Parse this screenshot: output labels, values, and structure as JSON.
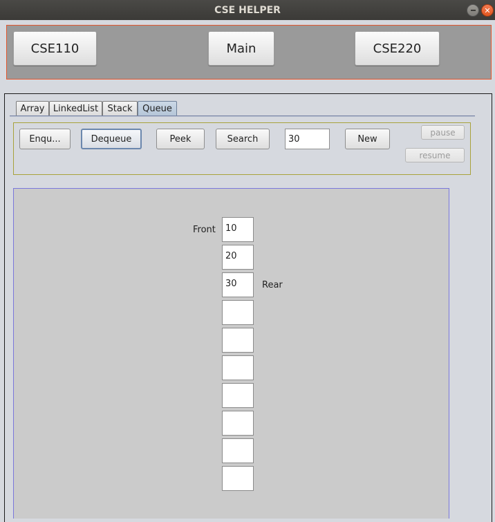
{
  "window": {
    "title": "CSE HELPER"
  },
  "nav": {
    "cse110": "CSE110",
    "main": "Main",
    "cse220": "CSE220"
  },
  "tabs": [
    "Array",
    "LinkedList",
    "Stack",
    "Queue"
  ],
  "active_tab": "Queue",
  "controls": {
    "enqueue": "Enqu...",
    "dequeue": "Dequeue",
    "peek": "Peek",
    "search": "Search",
    "input_value": "30",
    "new": "New",
    "pause": "pause",
    "resume": "resume"
  },
  "queue": {
    "front_label": "Front",
    "rear_label": "Rear",
    "cells": [
      "10",
      "20",
      "30",
      "",
      "",
      "",
      "",
      "",
      "",
      ""
    ]
  }
}
